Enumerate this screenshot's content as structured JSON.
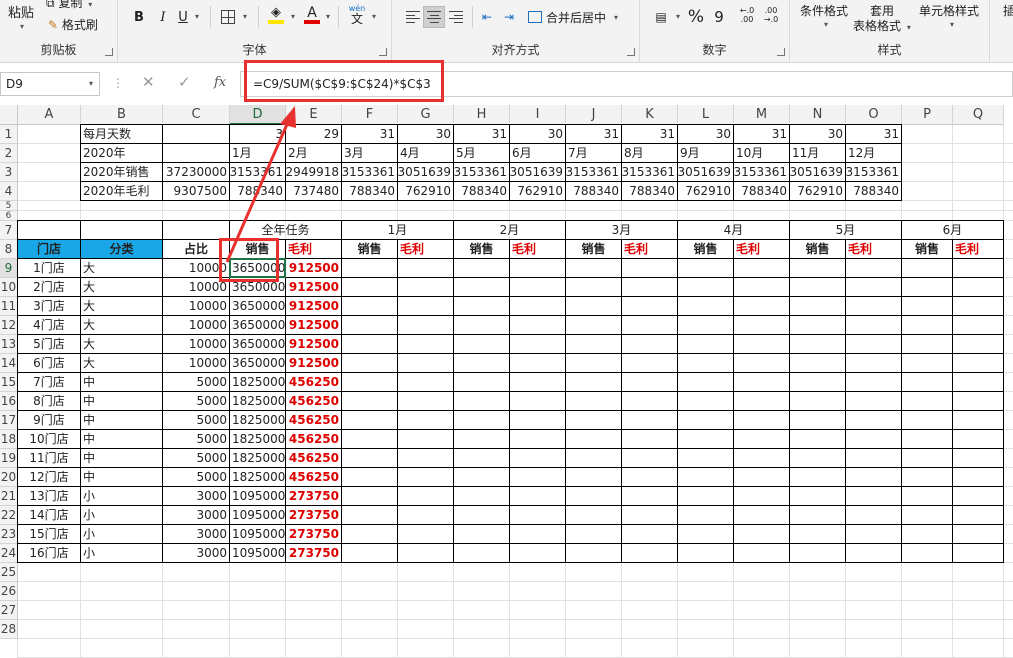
{
  "ribbon": {
    "clipboard": {
      "paste_label": "粘贴",
      "copy_label": "复制",
      "format_painter_label": "格式刷",
      "group_label": "剪贴板"
    },
    "font": {
      "group_label": "字体",
      "bold": "B",
      "italic": "I",
      "underline": "U",
      "font_color_glyph": "A",
      "pinyin_top": "wén",
      "pinyin_char": "文"
    },
    "alignment": {
      "merge_label": "合并后居中",
      "group_label": "对齐方式"
    },
    "number": {
      "percent": "%",
      "comma": "9",
      "inc_decimal": "←.0 .00",
      "dec_decimal": ".00 →.0",
      "group_label": "数字"
    },
    "styles": {
      "conditional_label": "条件格式",
      "table_label_1": "套用",
      "table_label_2": "表格格式",
      "cell_styles_label": "单元格样式",
      "group_label": "样式"
    },
    "insert_partial": "插",
    "colors": {
      "highlight": "#ffe600",
      "font_color": "#e00000"
    }
  },
  "formula_bar": {
    "name_box": "D9",
    "cancel_icon": "✕",
    "enter_icon": "✓",
    "fx_label": "fx",
    "formula": "=C9/SUM($C$9:$C$24)*$C$3"
  },
  "sheet": {
    "columns": [
      "A",
      "B",
      "C",
      "D",
      "E",
      "F",
      "G",
      "H",
      "I",
      "J",
      "K",
      "L",
      "M",
      "N",
      "O",
      "P",
      "Q"
    ],
    "rows": [
      "1",
      "2",
      "3",
      "4",
      "5",
      "6",
      "7",
      "8",
      "9",
      "10",
      "11",
      "12",
      "13",
      "14",
      "15",
      "16",
      "17",
      "18",
      "19",
      "20",
      "21",
      "22",
      "23",
      "24",
      "25",
      "26",
      "27",
      "28"
    ],
    "active_cell": "D9",
    "summary": {
      "days_label": "每月天数",
      "days": [
        "3",
        "29",
        "31",
        "30",
        "31",
        "30",
        "31",
        "31",
        "30",
        "31",
        "30",
        "31"
      ],
      "year_label": "2020年",
      "months": [
        "1月",
        "2月",
        "3月",
        "4月",
        "5月",
        "6月",
        "7月",
        "8月",
        "9月",
        "10月",
        "11月",
        "12月"
      ],
      "sales_label": "2020年销售",
      "sales_total": "37230000",
      "sales": [
        "3153361",
        "2949918",
        "3153361",
        "3051639",
        "3153361",
        "3051639",
        "3153361",
        "3153361",
        "3051639",
        "3153361",
        "3051639",
        "3153361"
      ],
      "profit_label": "2020年毛利",
      "profit_total": "9307500",
      "profit": [
        "788340",
        "737480",
        "788340",
        "762910",
        "788340",
        "762910",
        "788340",
        "788340",
        "762910",
        "788340",
        "762910",
        "788340"
      ]
    },
    "task_table": {
      "annual_task_label": "全年任务",
      "month_labels": [
        "1月",
        "2月",
        "3月",
        "4月",
        "5月",
        "6月"
      ],
      "store_header": "门店",
      "category_header": "分类",
      "share_header": "占比",
      "sales_header": "销售",
      "profit_header": "毛利",
      "stores": [
        {
          "store": "1门店",
          "cat": "大",
          "share": "10000",
          "sales": "3650000",
          "profit": "912500"
        },
        {
          "store": "2门店",
          "cat": "大",
          "share": "10000",
          "sales": "3650000",
          "profit": "912500"
        },
        {
          "store": "3门店",
          "cat": "大",
          "share": "10000",
          "sales": "3650000",
          "profit": "912500"
        },
        {
          "store": "4门店",
          "cat": "大",
          "share": "10000",
          "sales": "3650000",
          "profit": "912500"
        },
        {
          "store": "5门店",
          "cat": "大",
          "share": "10000",
          "sales": "3650000",
          "profit": "912500"
        },
        {
          "store": "6门店",
          "cat": "大",
          "share": "10000",
          "sales": "3650000",
          "profit": "912500"
        },
        {
          "store": "7门店",
          "cat": "中",
          "share": "5000",
          "sales": "1825000",
          "profit": "456250"
        },
        {
          "store": "8门店",
          "cat": "中",
          "share": "5000",
          "sales": "1825000",
          "profit": "456250"
        },
        {
          "store": "9门店",
          "cat": "中",
          "share": "5000",
          "sales": "1825000",
          "profit": "456250"
        },
        {
          "store": "10门店",
          "cat": "中",
          "share": "5000",
          "sales": "1825000",
          "profit": "456250"
        },
        {
          "store": "11门店",
          "cat": "中",
          "share": "5000",
          "sales": "1825000",
          "profit": "456250"
        },
        {
          "store": "12门店",
          "cat": "中",
          "share": "5000",
          "sales": "1825000",
          "profit": "456250"
        },
        {
          "store": "13门店",
          "cat": "小",
          "share": "3000",
          "sales": "1095000",
          "profit": "273750"
        },
        {
          "store": "14门店",
          "cat": "小",
          "share": "3000",
          "sales": "1095000",
          "profit": "273750"
        },
        {
          "store": "15门店",
          "cat": "小",
          "share": "3000",
          "sales": "1095000",
          "profit": "273750"
        },
        {
          "store": "16门店",
          "cat": "小",
          "share": "3000",
          "sales": "1095000",
          "profit": "273750"
        }
      ]
    },
    "colors": {
      "header_blue": "#1aa7e8",
      "profit_red": "#e00000",
      "annotation_red": "#e8312f",
      "selection_green": "#217346"
    }
  }
}
